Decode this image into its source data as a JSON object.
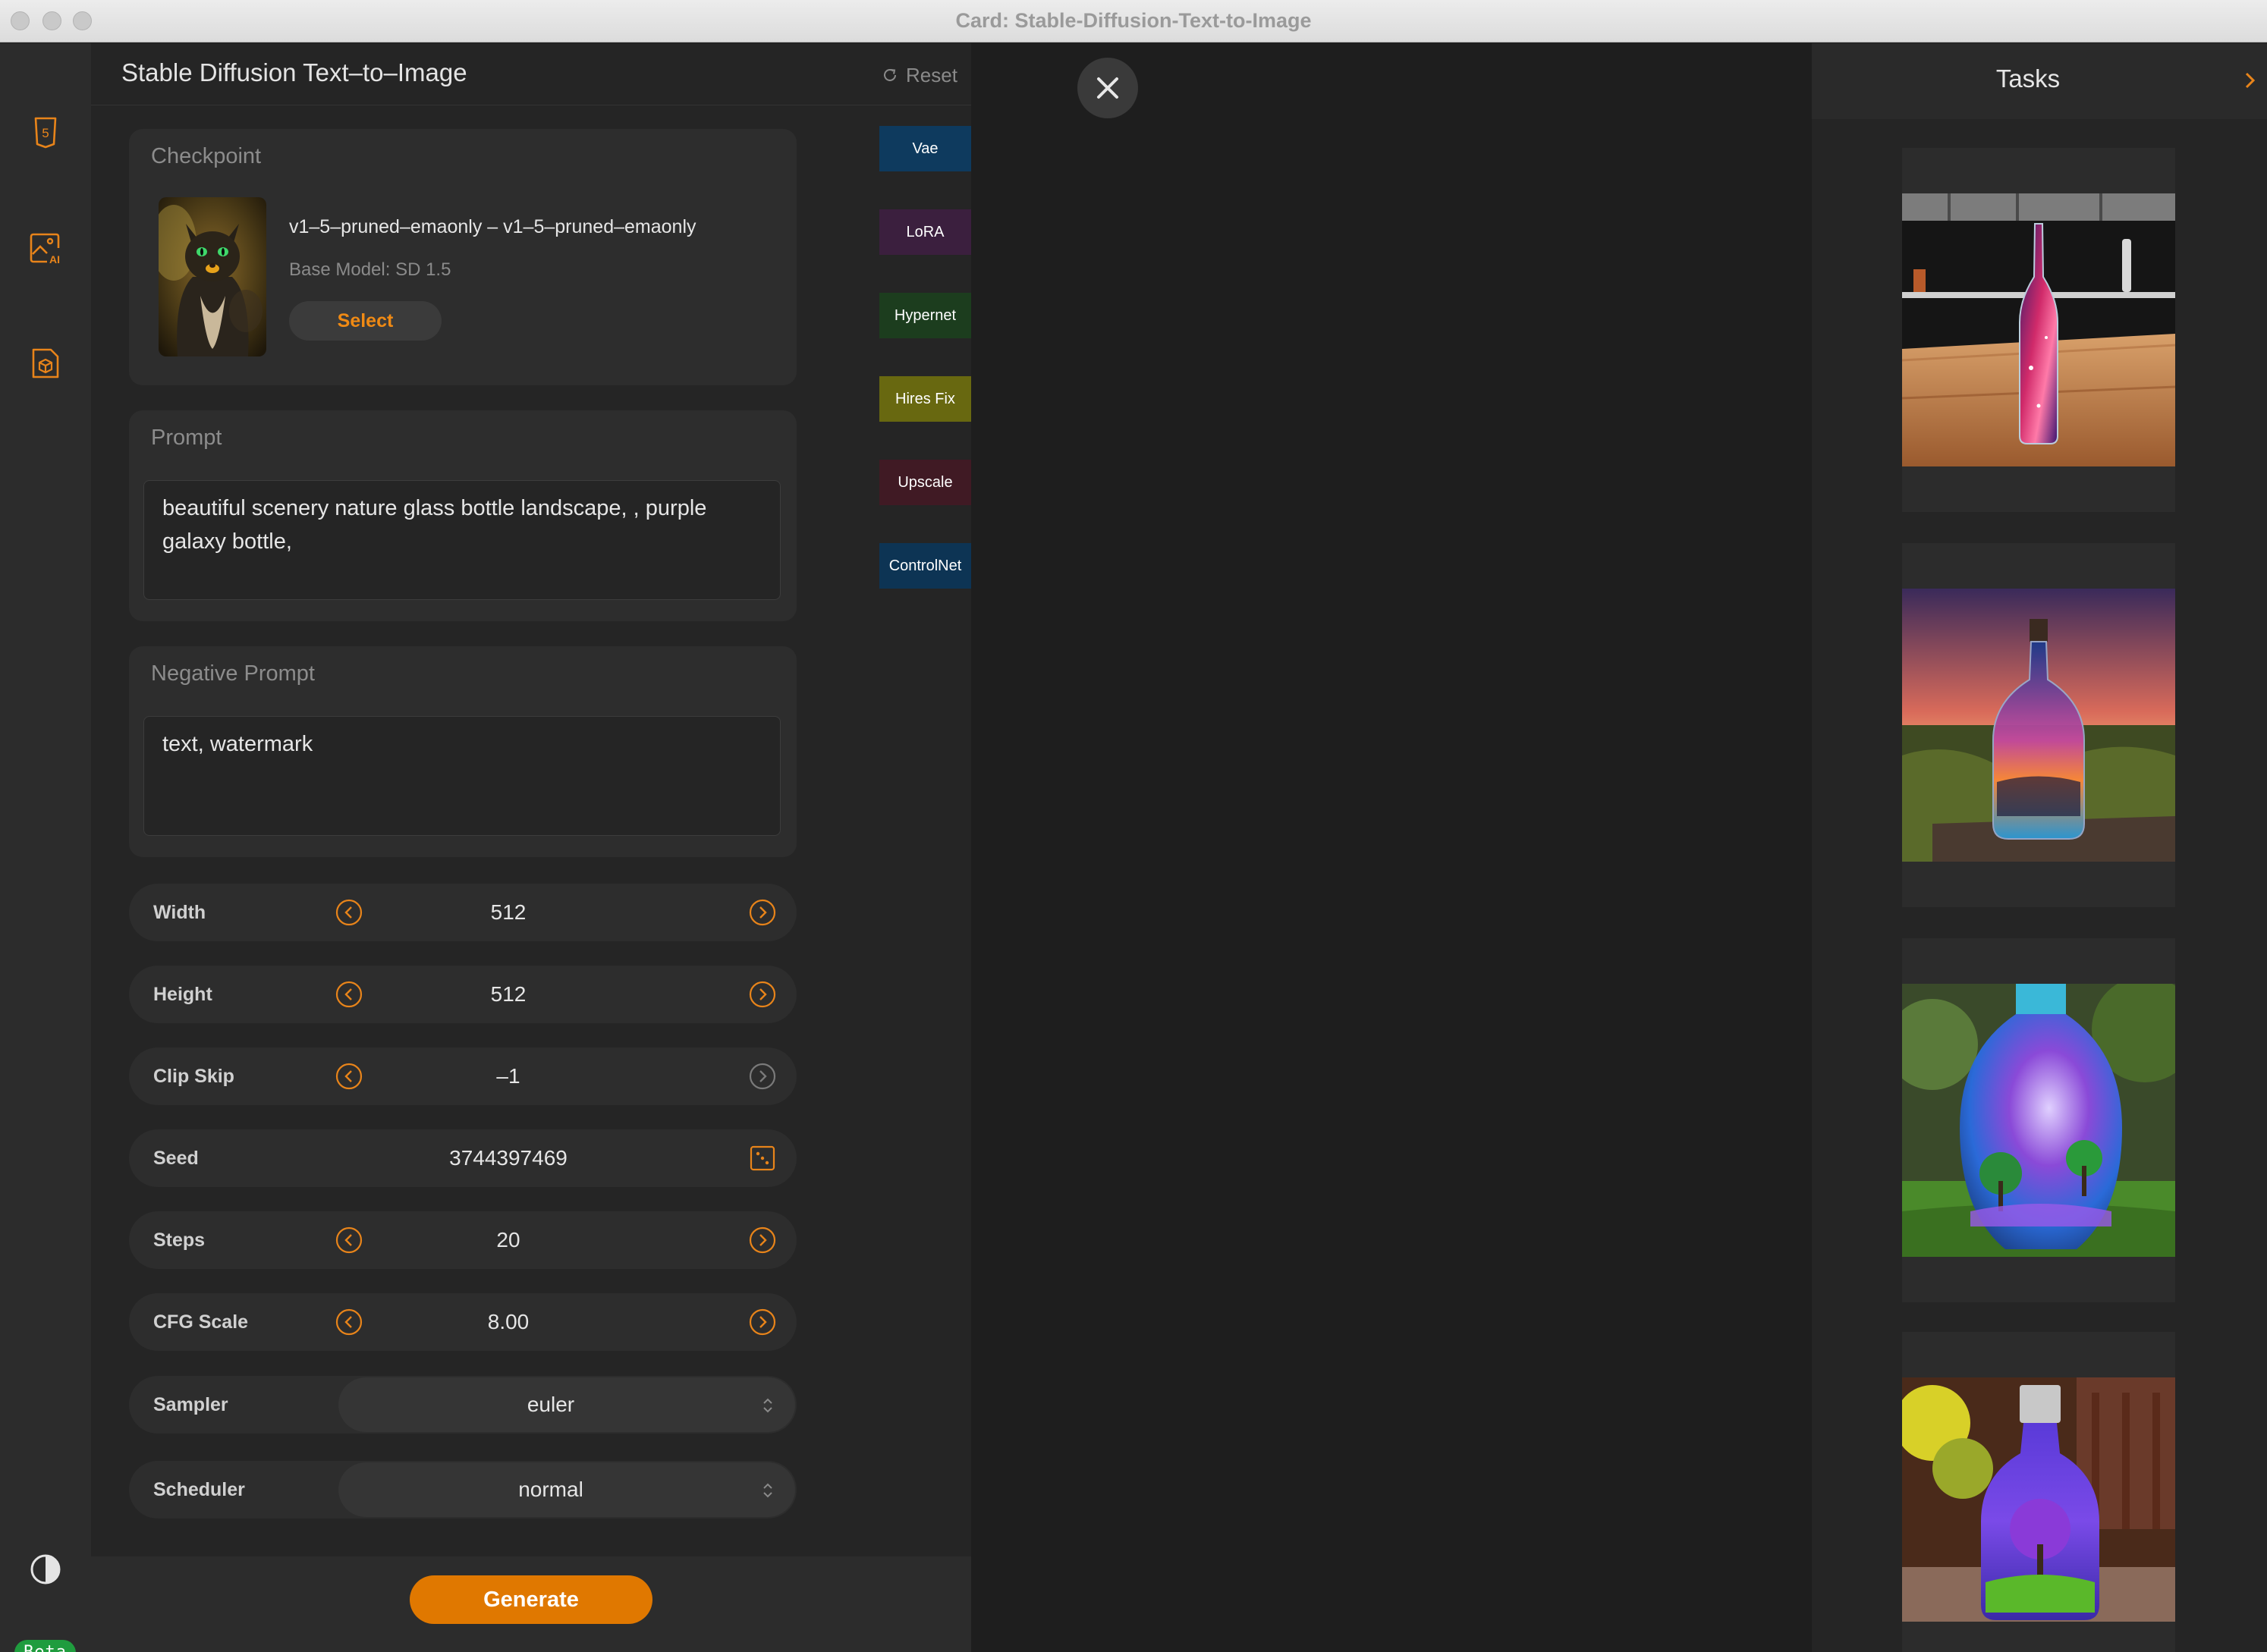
{
  "window": {
    "title": "Card: Stable-Diffusion-Text-to-Image"
  },
  "sidebar": {
    "icons": [
      "html5-icon",
      "ai-image-icon",
      "package-icon",
      "theme-contrast-icon"
    ],
    "badge": "Beta"
  },
  "panel": {
    "title": "Stable Diffusion Text–to–Image",
    "reset_label": "Reset"
  },
  "checkpoint": {
    "label": "Checkpoint",
    "model_name": "v1–5–pruned–emaonly – v1–5–pruned–emaonly",
    "base_model": "Base Model: SD 1.5",
    "select_label": "Select"
  },
  "prompt": {
    "label": "Prompt",
    "value": "beautiful scenery nature glass bottle landscape, , purple galaxy bottle,"
  },
  "negative_prompt": {
    "label": "Negative Prompt",
    "value": "text, watermark"
  },
  "params": {
    "width": {
      "label": "Width",
      "value": "512"
    },
    "height": {
      "label": "Height",
      "value": "512"
    },
    "clip_skip": {
      "label": "Clip Skip",
      "value": "–1"
    },
    "seed": {
      "label": "Seed",
      "value": "3744397469"
    },
    "steps": {
      "label": "Steps",
      "value": "20"
    },
    "cfg_scale": {
      "label": "CFG Scale",
      "value": "8.00"
    },
    "sampler": {
      "label": "Sampler",
      "value": "euler"
    },
    "scheduler": {
      "label": "Scheduler",
      "value": "normal"
    }
  },
  "generate_label": "Generate",
  "tags": [
    {
      "label": "Vae",
      "color": "#0e3a5e"
    },
    {
      "label": "LoRA",
      "color": "#3b1f3e"
    },
    {
      "label": "Hypernet",
      "color": "#1c3d1e"
    },
    {
      "label": "Hires Fix",
      "color": "#686810"
    },
    {
      "label": "Upscale",
      "color": "#401a24"
    },
    {
      "label": "ControlNet",
      "color": "#0d3454"
    }
  ],
  "tasks": {
    "title": "Tasks",
    "items": [
      "galaxy-bottle-on-table",
      "bottle-sunset-landscape",
      "galaxy-vase-with-trees",
      "purple-bottle-with-tree"
    ]
  },
  "colors": {
    "accent": "#f08a14",
    "generate": "#e07800",
    "beta": "#1f9c3e"
  }
}
